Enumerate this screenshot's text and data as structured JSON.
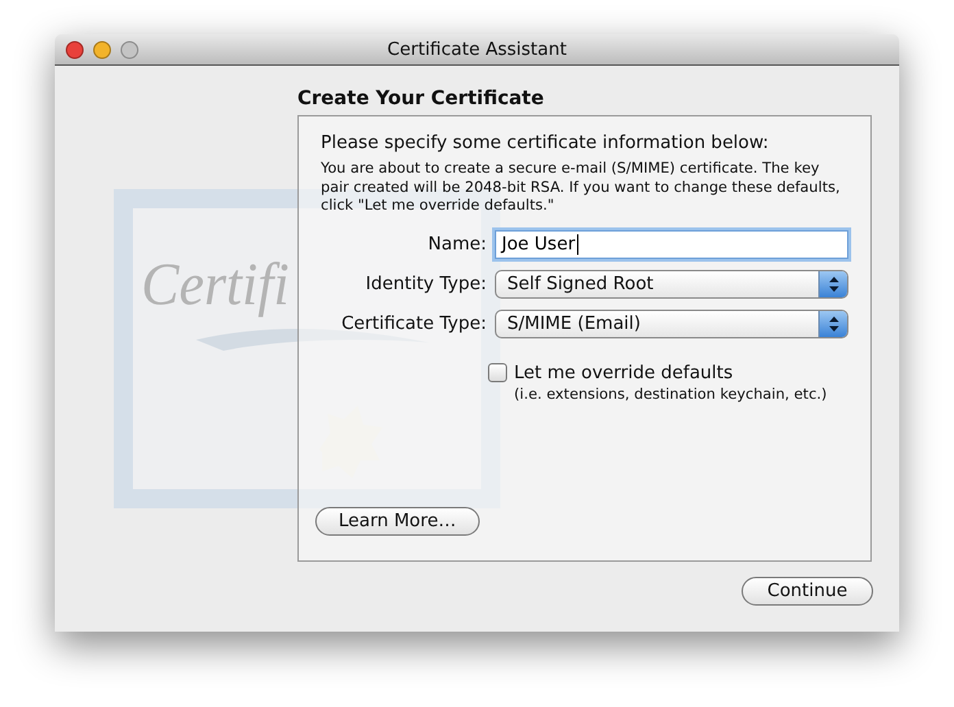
{
  "window": {
    "title": "Certificate Assistant",
    "controls": [
      {
        "kind": "close",
        "color": "#e8413b"
      },
      {
        "kind": "minimize",
        "color": "#f2b32a"
      },
      {
        "kind": "zoom",
        "color": "#c4c4c4"
      }
    ]
  },
  "artwork": {
    "text": "Certifi"
  },
  "heading": "Create Your Certificate",
  "panel": {
    "intro": "Please specify some certificate information below:",
    "description": "You are about to create a secure e-mail (S/MIME) certificate. The key pair created will be 2048-bit RSA. If you want to change these defaults, click \"Let me override defaults.\"",
    "fields": [
      {
        "kind": "text",
        "label": "Name:",
        "value": "Joe User",
        "focused": true
      },
      {
        "kind": "popup",
        "label": "Identity Type:",
        "value": "Self Signed Root",
        "focused": false
      },
      {
        "kind": "popup",
        "label": "Certificate Type:",
        "value": "S/MIME (Email)",
        "focused": false
      }
    ],
    "option": {
      "label": "Let me override defaults",
      "hint": "(i.e. extensions, destination keychain, etc.)",
      "checked": false
    },
    "learn_more": "Learn More…"
  },
  "continue": "Continue"
}
